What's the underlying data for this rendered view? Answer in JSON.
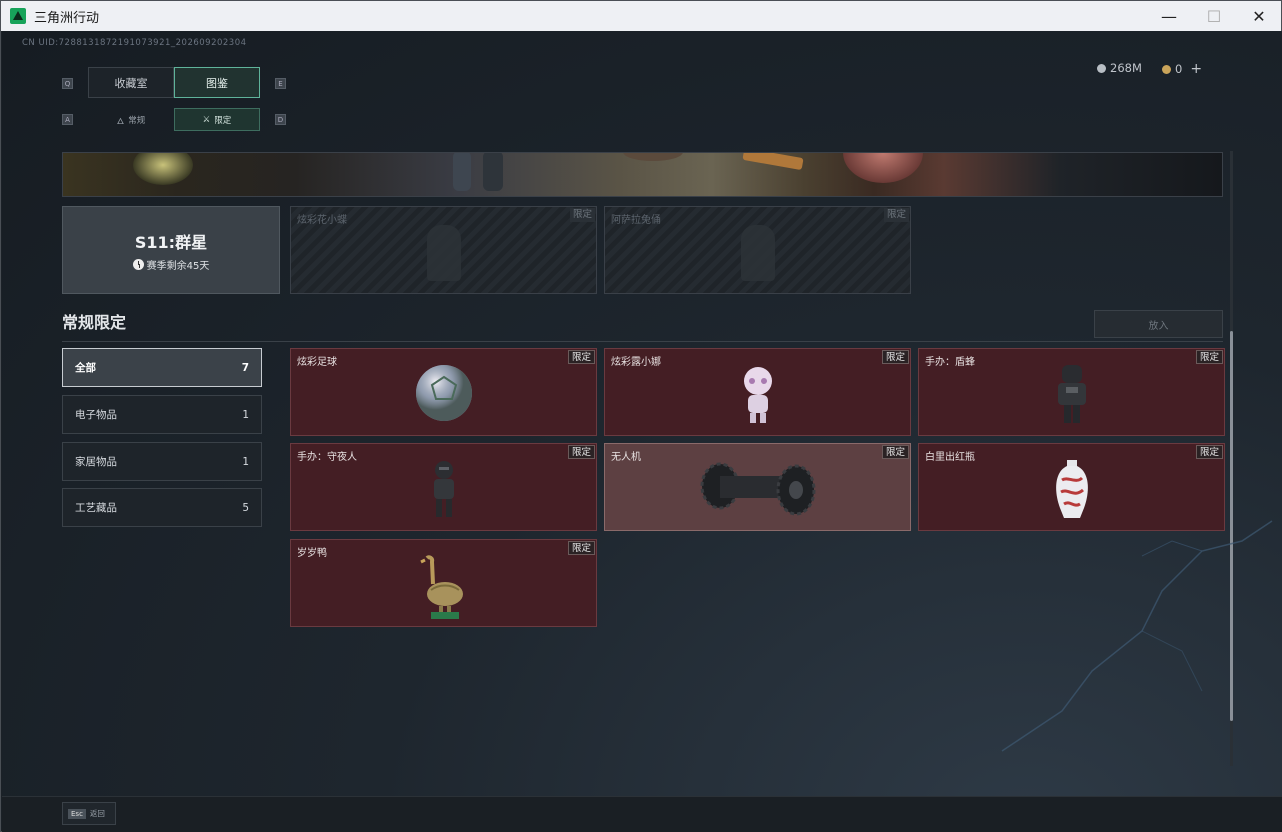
{
  "window": {
    "title": "三角洲行动",
    "controls": [
      "—",
      "☐",
      "✕"
    ]
  },
  "uid": "CN UID:7288131872191073921_202609202304",
  "tabs": {
    "left_key": "Q",
    "right_key": "E",
    "items": [
      {
        "label": "收藏室"
      },
      {
        "label": "图鉴"
      }
    ]
  },
  "subtabs": {
    "left_key": "A",
    "right_key": "D",
    "items": [
      {
        "label": "常规"
      },
      {
        "label": "限定"
      }
    ]
  },
  "currency": {
    "a": "268M",
    "b": "0",
    "plus": "+"
  },
  "season": {
    "title": "S11:群星",
    "remaining": "赛季剩余45天"
  },
  "locked_items": [
    {
      "name": "炫彩花小蝶",
      "tag": "限定"
    },
    {
      "name": "阿萨拉兔俑",
      "tag": "限定"
    }
  ],
  "section": {
    "title": "常规限定",
    "action": "放入"
  },
  "categories": [
    {
      "label": "全部",
      "count": "7"
    },
    {
      "label": "电子物品",
      "count": "1"
    },
    {
      "label": "家居物品",
      "count": "1"
    },
    {
      "label": "工艺藏品",
      "count": "5"
    }
  ],
  "items": [
    {
      "name": "炫彩足球",
      "tag": "限定",
      "icon": "soccer-ball"
    },
    {
      "name": "炫彩露小娜",
      "tag": "限定",
      "icon": "doll-figure"
    },
    {
      "name": "手办：盾蜂",
      "tag": "限定",
      "icon": "armored-figure"
    },
    {
      "name": "手办：守夜人",
      "tag": "限定",
      "icon": "soldier-figure"
    },
    {
      "name": "无人机",
      "tag": "限定",
      "icon": "drone-roller"
    },
    {
      "name": "白里出红瓶",
      "tag": "限定",
      "icon": "porcelain-vase"
    },
    {
      "name": "岁岁鸭",
      "tag": "限定",
      "icon": "bronze-duck"
    }
  ],
  "bottom": {
    "esc_key": "Esc",
    "esc_label": "返回"
  },
  "colors": {
    "accent": "#5fb39a",
    "item_bg": "#441e24",
    "highlight_bg": "#5d4042"
  }
}
